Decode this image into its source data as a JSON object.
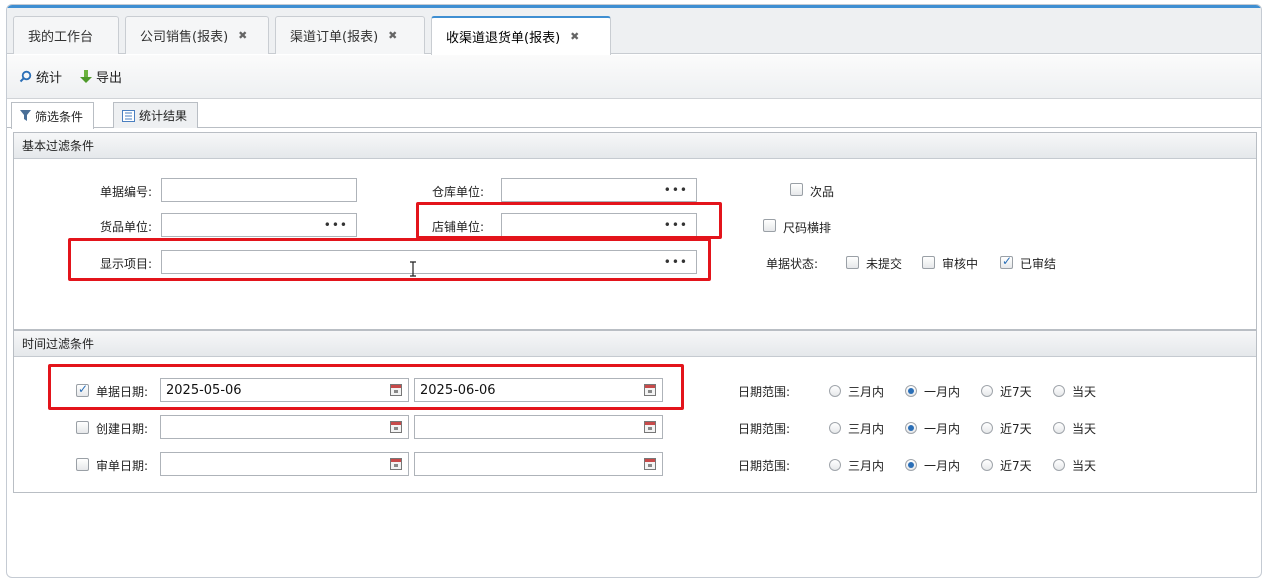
{
  "tabs": [
    {
      "label": "我的工作台",
      "closable": false
    },
    {
      "label": "公司销售(报表)",
      "closable": true
    },
    {
      "label": "渠道订单(报表)",
      "closable": true
    },
    {
      "label": "收渠道退货单(报表)",
      "closable": true,
      "active": true
    }
  ],
  "toolbar": {
    "stat_label": "统计",
    "export_label": "导出"
  },
  "subtabs": {
    "filter_label": "筛选条件",
    "result_label": "统计结果"
  },
  "basic": {
    "title": "基本过滤条件",
    "doc_no_label": "单据编号:",
    "doc_no_value": "",
    "warehouse_label": "仓库单位:",
    "warehouse_value": "",
    "goods_unit_label": "货品单位:",
    "goods_unit_value": "",
    "shop_label": "店铺单位:",
    "shop_value": "",
    "display_label": "显示项目:",
    "display_value": "",
    "defective_label": "次品",
    "size_row_label": "尺码横排",
    "status_label": "单据状态:",
    "status_options": [
      "未提交",
      "审核中",
      "已审结"
    ],
    "status_checked": [
      false,
      false,
      true
    ]
  },
  "time": {
    "title": "时间过滤条件",
    "rows": [
      {
        "label": "单据日期:",
        "checked": true,
        "from": "2025-05-06",
        "to": "2025-06-06"
      },
      {
        "label": "创建日期:",
        "checked": false,
        "from": "",
        "to": ""
      },
      {
        "label": "审单日期:",
        "checked": false,
        "from": "",
        "to": ""
      }
    ],
    "range_label": "日期范围:",
    "range_options": [
      "三月内",
      "一月内",
      "近7天",
      "当天"
    ],
    "range_selected": "一月内"
  },
  "colors": {
    "accent": "#3f8fd2",
    "highlight": "#e3141b"
  }
}
